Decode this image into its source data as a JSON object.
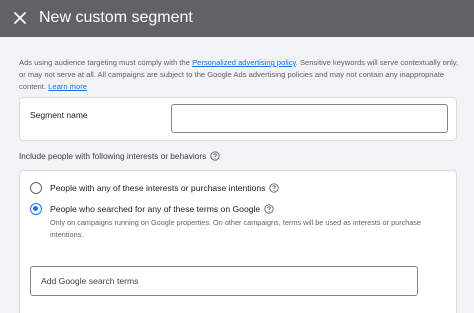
{
  "header": {
    "title": "New custom segment",
    "close_icon": "close-icon"
  },
  "notice": {
    "text_before": "Ads using audience targeting must comply with the ",
    "policy_link": "Personalized advertising policy",
    "text_after": ". Sensitive keywords will serve contextually only, or may not serve at all. All campaigns are subject to the Google Ads advertising policies and may not contain any inappropriate content. ",
    "learn_more": "Learn more"
  },
  "segment_name": {
    "label": "Segment name",
    "value": ""
  },
  "include": {
    "label": "Include people with following interests or behaviors",
    "help_icon": "help-icon"
  },
  "options": [
    {
      "label": "People with any of these interests or purchase intentions",
      "selected": false
    },
    {
      "label": "People who searched for any of these terms on Google",
      "selected": true,
      "description": "Only on campaigns running on Google properties. On other campaigns, terms will be used as interests or purchase intentions."
    }
  ],
  "search_terms": {
    "placeholder": "Add Google search terms"
  },
  "colors": {
    "header_bg": "#5f6368",
    "accent": "#1a73e8",
    "page_bg": "#f1f3f4"
  }
}
